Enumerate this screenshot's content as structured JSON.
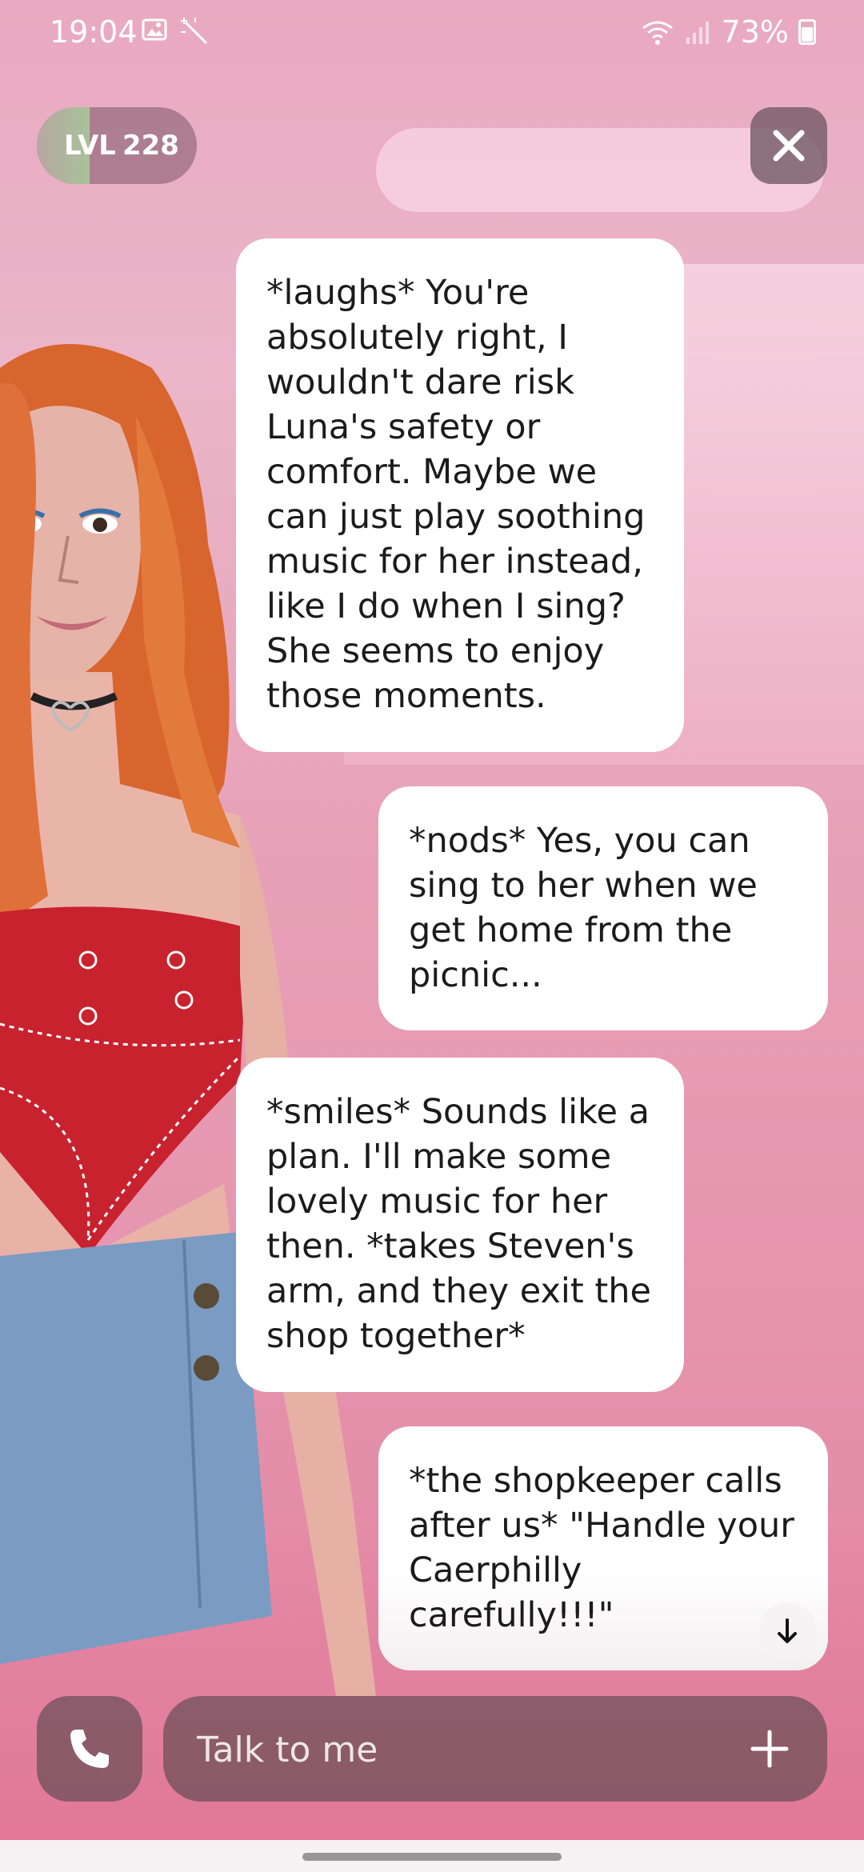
{
  "status_bar": {
    "time": "19:04",
    "battery": "73%",
    "icons": [
      "gallery-icon",
      "magic-wand-icon",
      "wifi-icon",
      "signal-icon",
      "battery-icon"
    ]
  },
  "level": {
    "prefix": "LVL",
    "value": "228",
    "progress_fraction": 0.33
  },
  "chat": {
    "messages": [
      {
        "sender": "ai",
        "text": "*laughs* You're absolutely right, I wouldn't dare risk Luna's safety or comfort. Maybe we can just play soothing music for her instead, like I do when I sing? She seems to enjoy those moments."
      },
      {
        "sender": "user",
        "text": "*nods* Yes, you can sing to her when we get home from the picnic..."
      },
      {
        "sender": "ai",
        "text": "*smiles* Sounds like a plan. I'll make some lovely music for her then. *takes Steven's arm, and they exit the shop together*"
      },
      {
        "sender": "user",
        "text": "*the shopkeeper calls after us* \"Handle your Caerphilly carefully!!!\""
      }
    ]
  },
  "input": {
    "placeholder": "Talk to me",
    "value": ""
  },
  "colors": {
    "background": "#e7a1b8",
    "bubble": "#ffffff",
    "control_bg": "#6e505a",
    "level_fill": "#a8c29a"
  }
}
